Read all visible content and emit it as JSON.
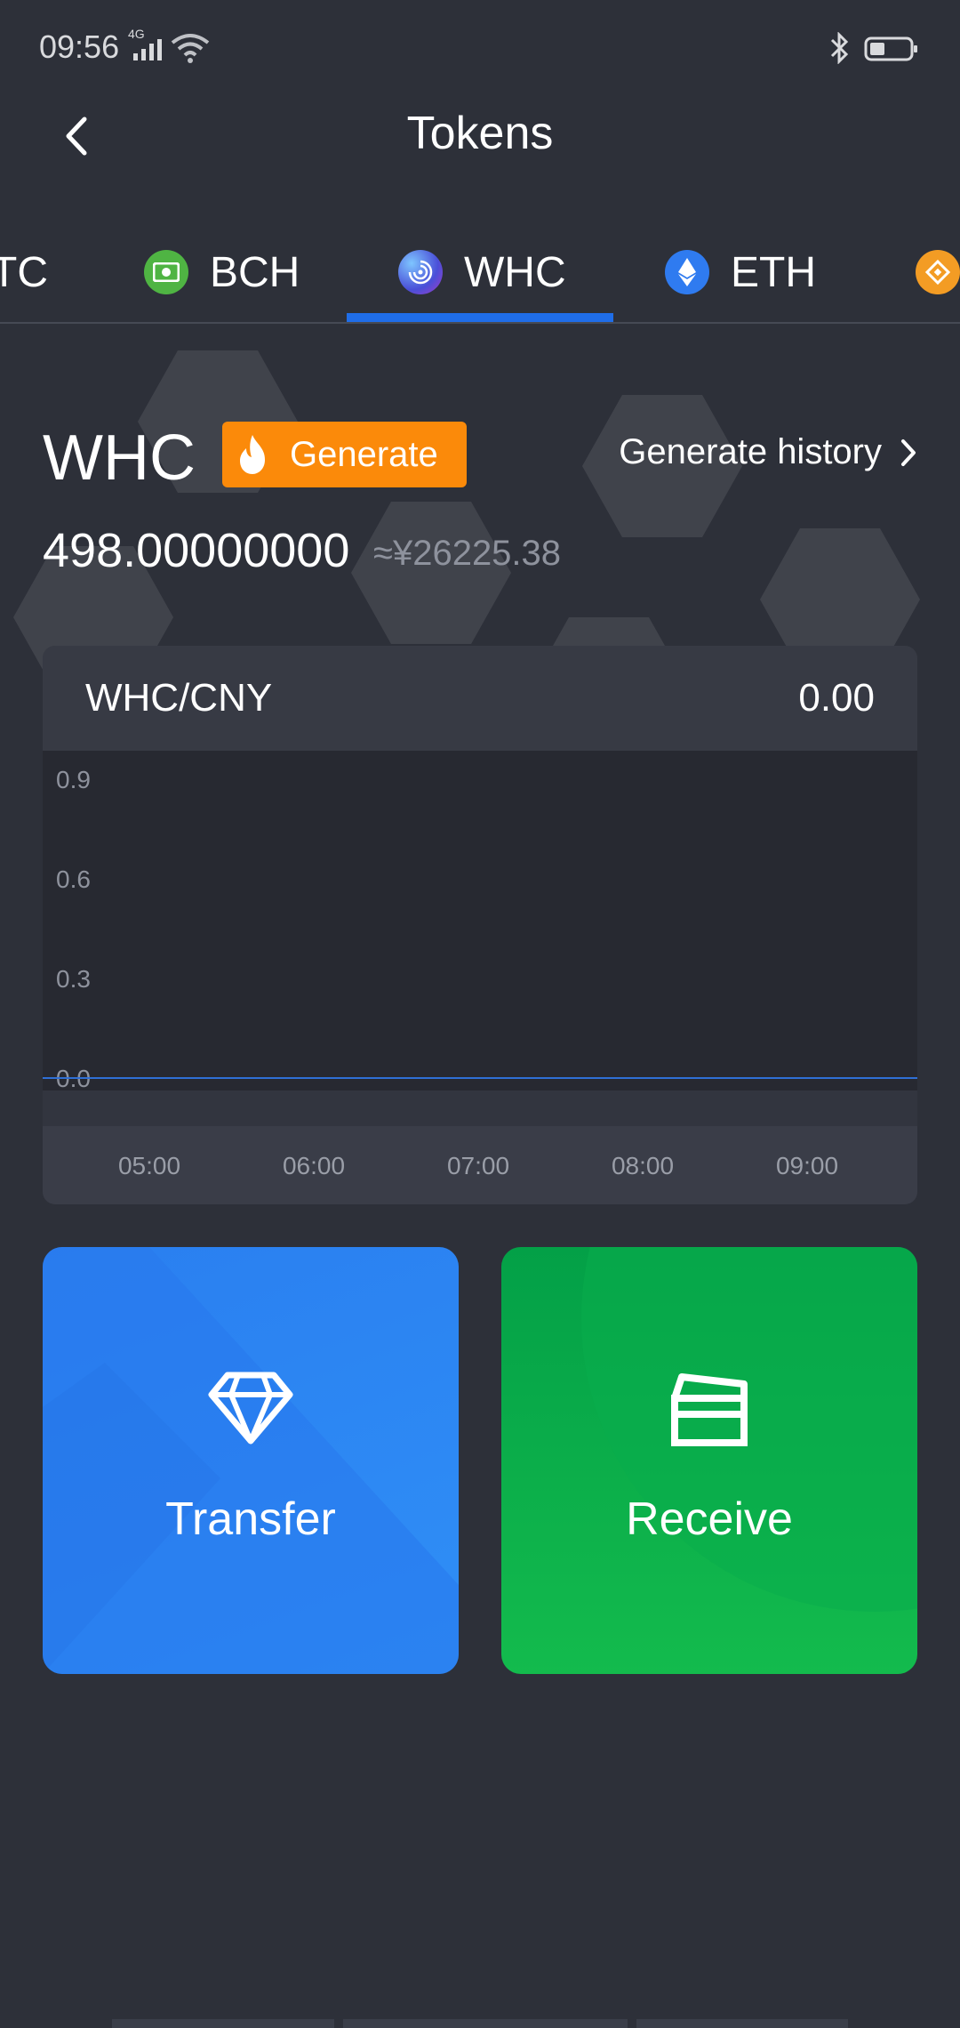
{
  "status_bar": {
    "time": "09:56",
    "network": "4G"
  },
  "header": {
    "title": "Tokens"
  },
  "tabs": [
    {
      "label": "TC",
      "active": false
    },
    {
      "label": "BCH",
      "active": false
    },
    {
      "label": "WHC",
      "active": true
    },
    {
      "label": "ETH",
      "active": false
    },
    {
      "label": "",
      "active": false
    }
  ],
  "token": {
    "symbol": "WHC",
    "generate_label": "Generate",
    "history_label": "Generate history",
    "balance": "498.00000000",
    "balance_fiat": "≈¥26225.38"
  },
  "chart_data": {
    "type": "line",
    "title": "WHC/CNY",
    "current_value": "0.00",
    "x": [
      "05:00",
      "06:00",
      "07:00",
      "08:00",
      "09:00"
    ],
    "series": [
      {
        "values": [
          0.0,
          0.0,
          0.0,
          0.0,
          0.0
        ]
      }
    ],
    "yticks": [
      "0.9",
      "0.6",
      "0.3",
      "0.0"
    ],
    "ylim": [
      0.0,
      0.9
    ],
    "xlabel": "",
    "ylabel": "",
    "grid": false,
    "line_color": "#2f6fd6"
  },
  "actions": {
    "transfer_label": "Transfer",
    "receive_label": "Receive"
  },
  "colors": {
    "background": "#2d3039",
    "accent": "#1f6de8",
    "generate": "#fb8a0a",
    "transfer": "#2a86f3",
    "receive": "#0fb24b"
  },
  "icons": {
    "back": "chevron-left-icon",
    "history": "chevron-right-icon",
    "generate": "flame-icon",
    "transfer": "diamond-icon",
    "receive": "receipt-icon"
  }
}
